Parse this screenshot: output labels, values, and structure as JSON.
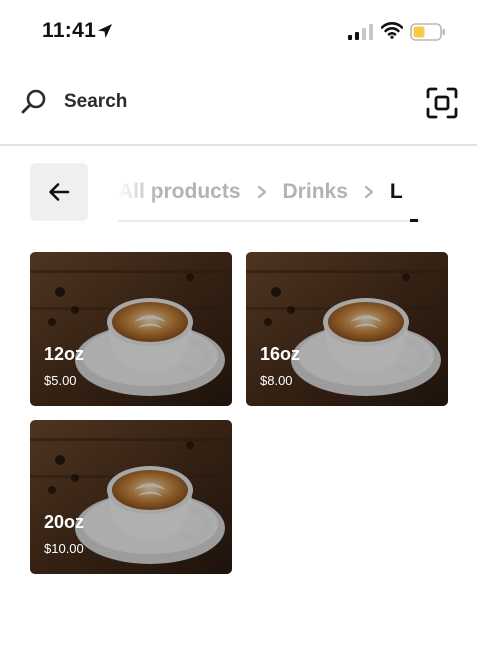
{
  "status_bar": {
    "time": "11:41",
    "battery_color": "#f7c948"
  },
  "search": {
    "label": "Search"
  },
  "breadcrumb": {
    "items": [
      "All products",
      "Drinks"
    ],
    "current": "L"
  },
  "products": [
    {
      "name": "12oz",
      "price": "$5.00"
    },
    {
      "name": "16oz",
      "price": "$8.00"
    },
    {
      "name": "20oz",
      "price": "$10.00"
    }
  ],
  "icons": {
    "search": "search-icon",
    "scan": "scan-icon",
    "back": "arrow-left-icon",
    "separator": "chevron-right-icon"
  }
}
